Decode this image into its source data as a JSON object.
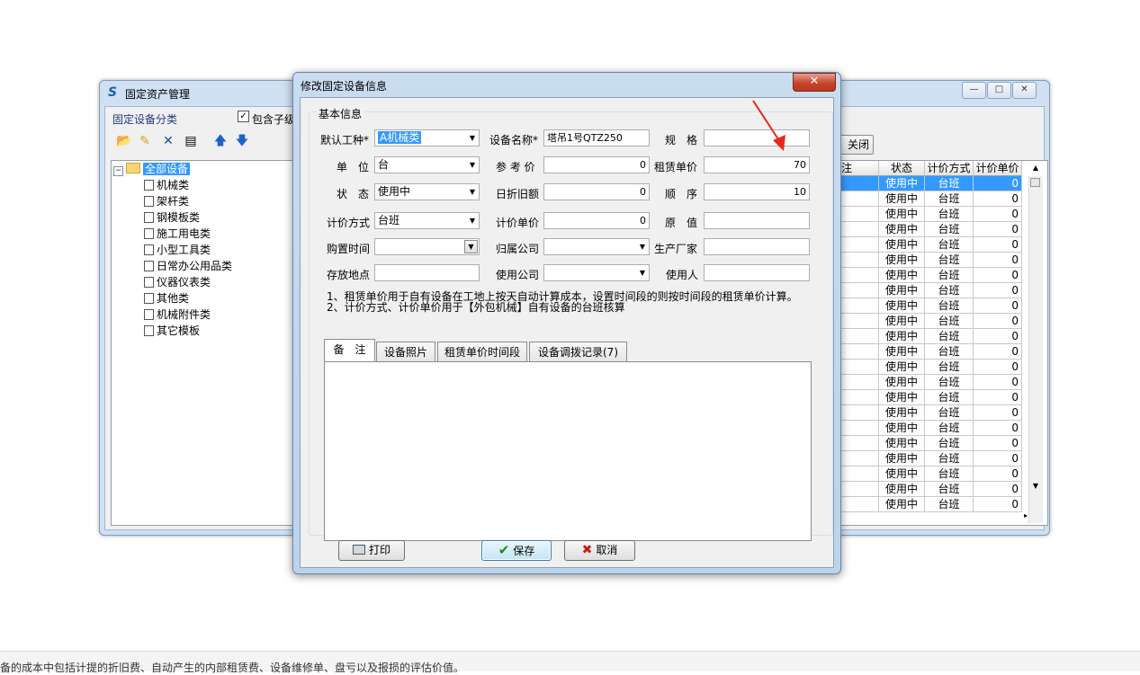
{
  "main_window": {
    "title": "固定资产管理",
    "category_label": "固定设备分类",
    "include_children_label": "包含子级",
    "include_children_checked": "✓",
    "toolbar_icons": [
      "open-folder-icon",
      "edit-folder-icon",
      "delete-icon",
      "export-icon",
      "move-up-icon",
      "move-down-icon"
    ],
    "close_button_label": "关闭",
    "tree": {
      "root": "全部设备",
      "items": [
        "机械类",
        "架杆类",
        "钢模板类",
        "施工用电类",
        "小型工具类",
        "日常办公用品类",
        "仪器仪表类",
        "其他类",
        "机械附件类",
        "其它模板"
      ]
    },
    "grid": {
      "columns": [
        "注",
        "状态",
        "计价方式",
        "计价单价"
      ],
      "rows": [
        [
          "",
          "使用中",
          "台班",
          "0"
        ],
        [
          "",
          "使用中",
          "台班",
          "0"
        ],
        [
          "",
          "使用中",
          "台班",
          "0"
        ],
        [
          "",
          "使用中",
          "台班",
          "0"
        ],
        [
          "",
          "使用中",
          "台班",
          "0"
        ],
        [
          "",
          "使用中",
          "台班",
          "0"
        ],
        [
          "",
          "使用中",
          "台班",
          "0"
        ],
        [
          "",
          "使用中",
          "台班",
          "0"
        ],
        [
          "",
          "使用中",
          "台班",
          "0"
        ],
        [
          "",
          "使用中",
          "台班",
          "0"
        ],
        [
          "",
          "使用中",
          "台班",
          "0"
        ],
        [
          "",
          "使用中",
          "台班",
          "0"
        ],
        [
          "",
          "使用中",
          "台班",
          "0"
        ],
        [
          "",
          "使用中",
          "台班",
          "0"
        ],
        [
          "",
          "使用中",
          "台班",
          "0"
        ],
        [
          "",
          "使用中",
          "台班",
          "0"
        ],
        [
          "",
          "使用中",
          "台班",
          "0"
        ],
        [
          "",
          "使用中",
          "台班",
          "0"
        ],
        [
          "",
          "使用中",
          "台班",
          "0"
        ],
        [
          "",
          "使用中",
          "台班",
          "0"
        ],
        [
          "",
          "使用中",
          "台班",
          "0"
        ],
        [
          "",
          "使用中",
          "台班",
          "0"
        ]
      ]
    }
  },
  "dialog": {
    "title": "修改固定设备信息",
    "close_glyph": "✕",
    "group_title": "基本信息",
    "fields": {
      "default_type_label": "默认工种*",
      "default_type_value": "A机械类",
      "device_name_label": "设备名称*",
      "device_name_value": "塔吊1号QTZ250",
      "spec_label": "规　格",
      "spec_value": "",
      "unit_label": "单　位",
      "unit_value": "台",
      "ref_price_label": "参 考 价",
      "ref_price_value": "0",
      "rent_price_label": "租赁单价",
      "rent_price_value": "70",
      "status_label": "状　态",
      "status_value": "使用中",
      "daily_depr_label": "日折旧额",
      "daily_depr_value": "0",
      "order_label": "顺　序",
      "order_value": "10",
      "pricing_method_label": "计价方式",
      "pricing_method_value": "台班",
      "pricing_price_label": "计价单价",
      "pricing_price_value": "0",
      "original_value_label": "原　值",
      "original_value_value": "",
      "purchase_time_label": "购置时间",
      "purchase_time_value": "",
      "company_label": "归属公司",
      "company_value": "",
      "manufacturer_label": "生产厂家",
      "manufacturer_value": "",
      "storage_label": "存放地点",
      "storage_value": "",
      "use_company_label": "使用公司",
      "use_company_value": "",
      "user_label": "使用人",
      "user_value": ""
    },
    "notes": [
      "1、租赁单价用于自有设备在工地上按天自动计算成本，设置时间段的则按时间段的租赁单价计算。",
      "2、计价方式、计价单价用于【外包机械】自有设备的台班核算"
    ],
    "tabs": [
      "备　注",
      "设备照片",
      "租赁单价时间段",
      "设备调拨记录(7)"
    ],
    "buttons": {
      "print": "打印",
      "save": "保存",
      "cancel": "取消"
    }
  },
  "status_bar": {
    "text": "备的成本中包括计提的折旧费、自动产生的内部租赁费、设备维修单、盘亏以及报损的评估价值。"
  },
  "colors": {
    "selection": "#3399ff",
    "annotation_arrow": "#e8281e",
    "dialog_close": "#c7452a"
  }
}
